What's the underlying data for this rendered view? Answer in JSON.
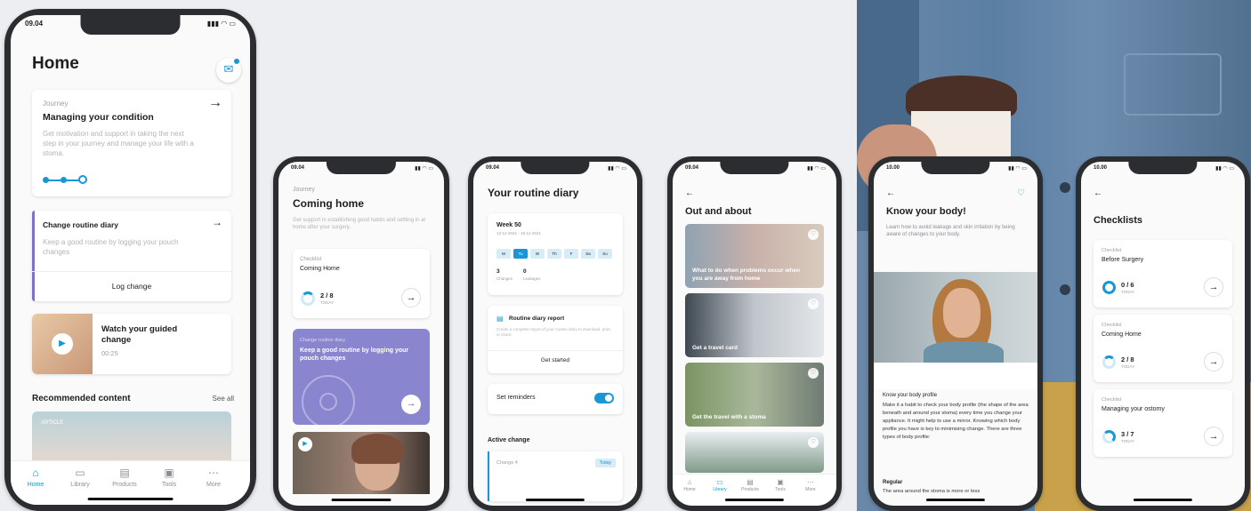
{
  "p1": {
    "time": "09.04",
    "title": "Home",
    "journey": {
      "eyebrow": "Journey",
      "title": "Managing your condition",
      "desc": "Get motivation and support in taking the next step in your journey and manage your life with a stoma."
    },
    "diary": {
      "title": "Change routine diary",
      "desc": "Keep a good routine by logging your pouch changes",
      "action": "Log change"
    },
    "video": {
      "title": "Watch your guided change",
      "duration": "00:25"
    },
    "recommended": {
      "title": "Recommended content",
      "see_all": "See all",
      "tag": "Article"
    },
    "tabs": [
      "Home",
      "Library",
      "Products",
      "Tools",
      "More"
    ]
  },
  "p2": {
    "time": "09.04",
    "eyebrow": "Journey",
    "title": "Coming home",
    "desc": "Get support in establishing good habits and settling in at home after your surgery.",
    "checklist": {
      "eyebrow": "Checklist",
      "title": "Coming Home",
      "progress": "2 / 8",
      "progress_sub": "TODAY"
    },
    "promo": {
      "eyebrow": "Change routine diary",
      "title": "Keep a good routine by logging your pouch changes"
    }
  },
  "p3": {
    "time": "09.04",
    "title": "Your routine diary",
    "week": {
      "title": "Week 50",
      "range": "12-12-2021 - 18-12-2021",
      "days": [
        "M",
        "Tu",
        "W",
        "Th",
        "F",
        "Sa",
        "Su"
      ],
      "stat1_value": "3",
      "stat1_label": "Changes",
      "stat2_value": "0",
      "stat2_label": "Leakages"
    },
    "report": {
      "title": "Routine diary report",
      "desc": "Create a complete report of your routine diary to download, print, or share.",
      "action": "Get started"
    },
    "reminders": "Set reminders",
    "active": {
      "title": "Active change",
      "item": "Change 4",
      "badge": "Today"
    }
  },
  "p4": {
    "time": "09.04",
    "title": "Out and about",
    "cards": [
      "What to do when problems occur when you are away from home",
      "Get a travel card",
      "Get the travel with a stoma",
      ""
    ],
    "tabs": [
      "Home",
      "Library",
      "Products",
      "Tools",
      "More"
    ]
  },
  "p5": {
    "time": "10.00",
    "title": "Know your body!",
    "desc": "Learn how to avoid leakage and skin irritation by being aware of changes to your body.",
    "section_title": "Know your body profile",
    "body": "Make it a habit to check your body profile (the shape of the area beneath and around your stoma) every time you change your appliance. It might help to use a mirror. Knowing which body profile you have is key to minimising change. There are three types of body profile:",
    "sub": "Regular",
    "sub_body": "The area around the stoma is more or less"
  },
  "p6": {
    "time": "10.00",
    "title": "Checklists",
    "items": [
      {
        "eyebrow": "Checklist",
        "title": "Before Surgery",
        "progress": "0 / 6",
        "sub": "TODAY"
      },
      {
        "eyebrow": "Checklist",
        "title": "Coming Home",
        "progress": "2 / 8",
        "sub": "TODAY"
      },
      {
        "eyebrow": "Checklist",
        "title": "Managing your ostomy",
        "progress": "3 / 7",
        "sub": "TODAY"
      }
    ]
  },
  "colors": {
    "accent": "#1996d4",
    "purple": "#8a85cf",
    "diary_bar": "#7b73c9"
  }
}
